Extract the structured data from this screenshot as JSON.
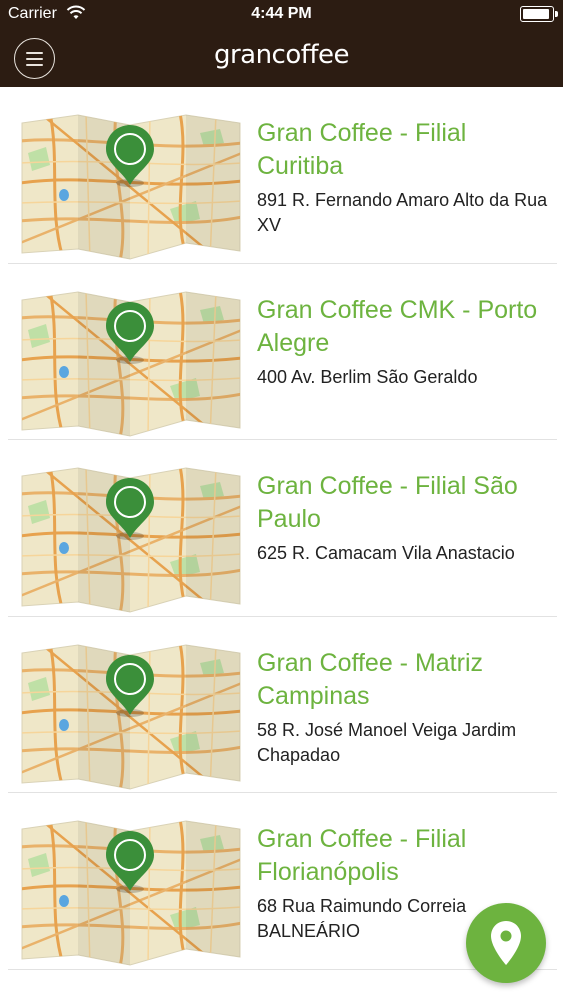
{
  "status_bar": {
    "carrier": "Carrier",
    "time": "4:44 PM"
  },
  "header": {
    "logo_text": "grancoffee"
  },
  "locations": [
    {
      "name": "Gran Coffee - Filial Curitiba",
      "address": "891 R. Fernando Amaro Alto da Rua XV"
    },
    {
      "name": "Gran Coffee CMK - Porto Alegre",
      "address": "400 Av. Berlim São Geraldo"
    },
    {
      "name": "Gran Coffee - Filial São Paulo",
      "address": "625 R. Camacam Vila Anastacio"
    },
    {
      "name": "Gran Coffee - Matriz Campinas",
      "address": "58 R. José Manoel Veiga Jardim Chapadao"
    },
    {
      "name": "Gran Coffee - Filial Florianópolis",
      "address": "68 Rua Raimundo Correia BALNEÁRIO"
    }
  ],
  "colors": {
    "header_bg": "#2c1c12",
    "accent_green": "#6db33f",
    "pin_green": "#3b8f3a"
  },
  "icons": {
    "menu": "hamburger-icon",
    "map": "map-thumbnail-icon",
    "fab": "location-pin-icon"
  }
}
